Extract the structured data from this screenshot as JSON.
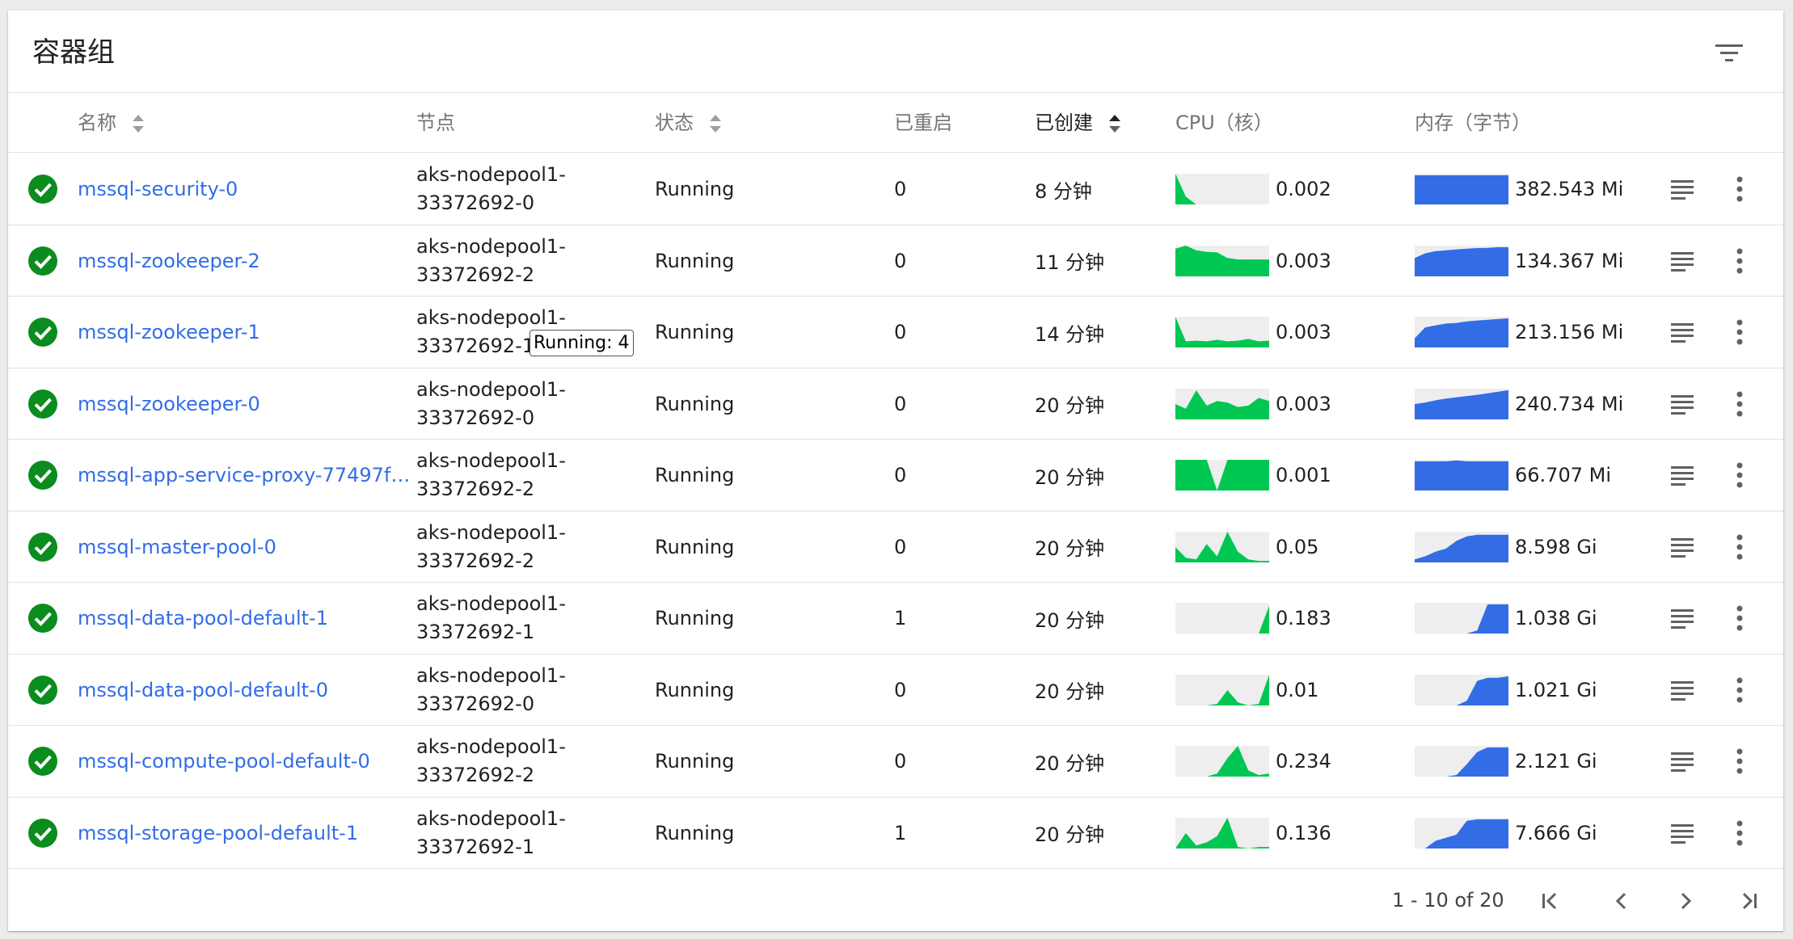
{
  "card": {
    "title": "容器组"
  },
  "columns": {
    "name": "名称",
    "node": "节点",
    "status": "状态",
    "restarts": "已重启",
    "created": "已创建",
    "cpu": "CPU（核）",
    "memory": "内存（字节）"
  },
  "colors": {
    "ok": "#0b8c1e",
    "link": "#326de6",
    "cpu": "#00c752",
    "memory": "#326de6",
    "sparkBg": "#eeeeee"
  },
  "rows": [
    {
      "name": "mssql-security-0",
      "node_line1": "aks-nodepool1-",
      "node_line2": "33372692-0",
      "status": "Running",
      "restarts": "0",
      "created": "8 分钟",
      "cpu": "0.002",
      "memory": "382.543 Mi",
      "cpu_series": [
        1.0,
        0.25,
        0,
        0,
        0,
        0,
        0,
        0,
        0,
        0
      ],
      "mem_series": [
        0.95,
        0.95,
        0.95,
        0.95,
        0.95,
        0.95,
        0.95,
        0.95,
        0.95,
        0.95
      ]
    },
    {
      "name": "mssql-zookeeper-2",
      "node_line1": "aks-nodepool1-",
      "node_line2": "33372692-2",
      "status": "Running",
      "restarts": "0",
      "created": "11 分钟",
      "cpu": "0.003",
      "memory": "134.367 Mi",
      "cpu_series": [
        0.9,
        1.0,
        0.85,
        0.8,
        0.78,
        0.6,
        0.55,
        0.55,
        0.55,
        0.55
      ],
      "mem_series": [
        0.6,
        0.75,
        0.82,
        0.85,
        0.88,
        0.9,
        0.92,
        0.93,
        0.95,
        0.95
      ]
    },
    {
      "name": "mssql-zookeeper-1",
      "node_line1": "aks-nodepool1-",
      "node_line2": "33372692-1",
      "status": "Running",
      "restarts": "0",
      "created": "14 分钟",
      "cpu": "0.003",
      "memory": "213.156 Mi",
      "cpu_series": [
        1.0,
        0.2,
        0.22,
        0.2,
        0.25,
        0.2,
        0.22,
        0.28,
        0.2,
        0.22
      ],
      "mem_series": [
        0.3,
        0.65,
        0.72,
        0.78,
        0.8,
        0.85,
        0.88,
        0.9,
        0.93,
        0.95
      ]
    },
    {
      "name": "mssql-zookeeper-0",
      "node_line1": "aks-nodepool1-",
      "node_line2": "33372692-0",
      "status": "Running",
      "restarts": "0",
      "created": "20 分钟",
      "cpu": "0.003",
      "memory": "240.734 Mi",
      "cpu_series": [
        0.5,
        0.35,
        0.95,
        0.45,
        0.6,
        0.55,
        0.4,
        0.45,
        0.7,
        0.6
      ],
      "mem_series": [
        0.5,
        0.55,
        0.62,
        0.68,
        0.72,
        0.76,
        0.8,
        0.85,
        0.9,
        0.95
      ]
    },
    {
      "name": "mssql-app-service-proxy-77497f…",
      "node_line1": "aks-nodepool1-",
      "node_line2": "33372692-2",
      "status": "Running",
      "restarts": "0",
      "created": "20 分钟",
      "cpu": "0.001",
      "memory": "66.707 Mi",
      "cpu_series": [
        1.0,
        1.0,
        1.0,
        1.0,
        0.0,
        1.0,
        1.0,
        1.0,
        1.0,
        1.0
      ],
      "mem_series": [
        0.95,
        0.95,
        0.95,
        0.95,
        0.98,
        0.95,
        0.95,
        0.95,
        0.95,
        0.95
      ]
    },
    {
      "name": "mssql-master-pool-0",
      "node_line1": "aks-nodepool1-",
      "node_line2": "33372692-2",
      "status": "Running",
      "restarts": "0",
      "created": "20 分钟",
      "cpu": "0.05",
      "memory": "8.598 Gi",
      "cpu_series": [
        0.5,
        0.15,
        0.1,
        0.6,
        0.2,
        1.0,
        0.35,
        0.1,
        0.05,
        0.05
      ],
      "mem_series": [
        0.1,
        0.2,
        0.35,
        0.45,
        0.7,
        0.85,
        0.9,
        0.9,
        0.9,
        0.9
      ]
    },
    {
      "name": "mssql-data-pool-default-1",
      "node_line1": "aks-nodepool1-",
      "node_line2": "33372692-1",
      "status": "Running",
      "restarts": "1",
      "created": "20 分钟",
      "cpu": "0.183",
      "memory": "1.038 Gi",
      "cpu_series": [
        0,
        0,
        0,
        0,
        0,
        0,
        0,
        0,
        0,
        0.9
      ],
      "mem_series": [
        0,
        0,
        0,
        0,
        0,
        0,
        0.1,
        0.95,
        0.95,
        0.95
      ]
    },
    {
      "name": "mssql-data-pool-default-0",
      "node_line1": "aks-nodepool1-",
      "node_line2": "33372692-0",
      "status": "Running",
      "restarts": "0",
      "created": "20 分钟",
      "cpu": "0.01",
      "memory": "1.021 Gi",
      "cpu_series": [
        0,
        0,
        0,
        0,
        0.05,
        0.5,
        0.1,
        0,
        0.05,
        1.0
      ],
      "mem_series": [
        0,
        0,
        0,
        0,
        0,
        0.15,
        0.8,
        0.9,
        0.9,
        0.95
      ]
    },
    {
      "name": "mssql-compute-pool-default-0",
      "node_line1": "aks-nodepool1-",
      "node_line2": "33372692-2",
      "status": "Running",
      "restarts": "0",
      "created": "20 分钟",
      "cpu": "0.234",
      "memory": "2.121 Gi",
      "cpu_series": [
        0,
        0,
        0,
        0,
        0.1,
        0.6,
        1.0,
        0.2,
        0.05,
        0.1
      ],
      "mem_series": [
        0,
        0,
        0,
        0,
        0.05,
        0.4,
        0.8,
        0.95,
        0.95,
        0.95
      ]
    },
    {
      "name": "mssql-storage-pool-default-1",
      "node_line1": "aks-nodepool1-",
      "node_line2": "33372692-1",
      "status": "Running",
      "restarts": "1",
      "created": "20 分钟",
      "cpu": "0.136",
      "memory": "7.666 Gi",
      "cpu_series": [
        0,
        0.5,
        0.1,
        0.2,
        0.4,
        1.0,
        0.05,
        0,
        0.05,
        0.05
      ],
      "mem_series": [
        0,
        0,
        0.25,
        0.35,
        0.45,
        0.9,
        0.95,
        0.95,
        0.95,
        0.95
      ]
    }
  ],
  "tooltip": {
    "text": "Running: 4"
  },
  "pagination": {
    "range": "1 - 10 of 20"
  }
}
